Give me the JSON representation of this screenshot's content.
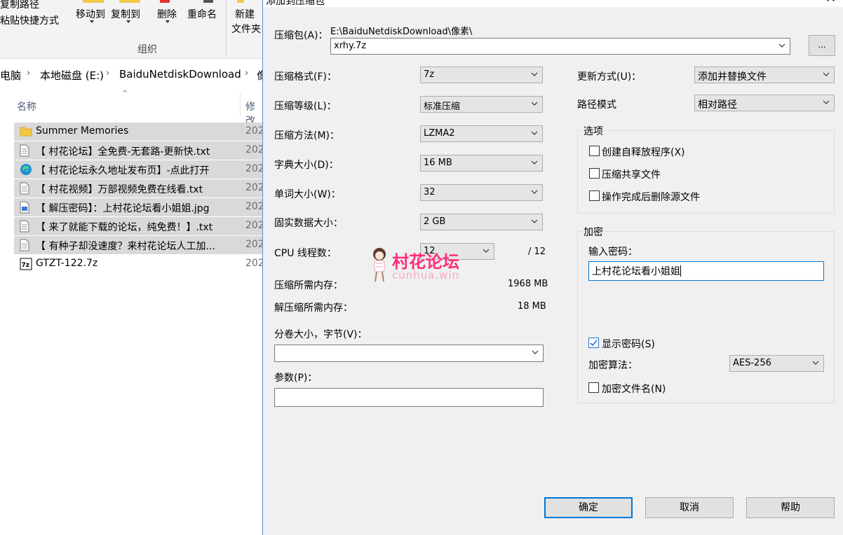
{
  "explorer": {
    "ribbon": {
      "copy_path": "复制路径",
      "paste_shortcut": "粘贴快捷方式",
      "move_to": "移动到",
      "copy_to": "复制到",
      "delete": "删除",
      "rename": "重命名",
      "new": "新建",
      "new_folder": "文件夹",
      "group_label": "组织"
    },
    "breadcrumb": [
      "电脑",
      "本地磁盘 (E:)",
      "BaiduNetdiskDownload",
      "像"
    ],
    "columns": {
      "name": "名称",
      "modified": "修改"
    },
    "files": [
      {
        "name": "Summer Memories",
        "date": "202",
        "icon": "folder-icon",
        "selected": true
      },
      {
        "name": "【 村花论坛】全免费-无套路-更新快.txt",
        "date": "202",
        "icon": "text-file-icon",
        "selected": true
      },
      {
        "name": "【 村花论坛永久地址发布页】-点此打开",
        "date": "202",
        "icon": "edge-browser-icon",
        "selected": true
      },
      {
        "name": "【 村花视频】万部视频免费在线看.txt",
        "date": "202",
        "icon": "text-file-icon",
        "selected": true
      },
      {
        "name": "【 解压密码】：上村花论坛看小姐姐.jpg",
        "date": "202",
        "icon": "image-file-icon",
        "selected": true
      },
      {
        "name": "【 来了就能下载的论坛，纯免费！】.txt",
        "date": "202",
        "icon": "text-file-icon",
        "selected": true
      },
      {
        "name": "【 有种子却没速度？来村花论坛人工加...",
        "date": "202",
        "icon": "text-file-icon",
        "selected": true
      },
      {
        "name": "GTZT-122.7z",
        "date": "202",
        "icon": "7z-archive-icon",
        "selected": false
      }
    ]
  },
  "dialog": {
    "title": "添加到压缩包",
    "archive_label": "压缩包(A)：",
    "archive_path": "E:\\BaiduNetdiskDownload\\像素\\",
    "archive_name": "xrhy.7z",
    "browse_label": "...",
    "left": {
      "format": {
        "label": "压缩格式(F)：",
        "value": "7z"
      },
      "level": {
        "label": "压缩等级(L)：",
        "value": "标准压缩"
      },
      "method": {
        "label": "压缩方法(M)：",
        "value": "LZMA2"
      },
      "dict": {
        "label": "字典大小(D)：",
        "value": "16 MB"
      },
      "word": {
        "label": "单词大小(W)：",
        "value": "32"
      },
      "solid": {
        "label": "固实数据大小：",
        "value": "2 GB"
      },
      "threads": {
        "label": "CPU 线程数：",
        "value": "12",
        "max": "/ 12"
      },
      "mem_compress": {
        "label": "压缩所需内存：",
        "value": "1968 MB"
      },
      "mem_decompress": {
        "label": "解压缩所需内存：",
        "value": "18 MB"
      },
      "volume": {
        "label": "分卷大小，字节(V)：",
        "value": ""
      },
      "params": {
        "label": "参数(P)：",
        "value": ""
      }
    },
    "right": {
      "update": {
        "label": "更新方式(U)：",
        "value": "添加并替换文件"
      },
      "path_mode": {
        "label": "路径模式",
        "value": "相对路径"
      },
      "options": {
        "title": "选项",
        "sfx": {
          "label": "创建自释放程序(X)",
          "checked": false
        },
        "shared": {
          "label": "压缩共享文件",
          "checked": false
        },
        "delete_after": {
          "label": "操作完成后删除源文件",
          "checked": false
        }
      },
      "encryption": {
        "title": "加密",
        "password_label": "输入密码：",
        "password": "上村花论坛看小姐姐",
        "show_password": {
          "label": "显示密码(S)",
          "checked": true
        },
        "algo_label": "加密算法：",
        "algo": "AES-256",
        "encrypt_names": {
          "label": "加密文件名(N)",
          "checked": false
        }
      }
    },
    "buttons": {
      "ok": "确定",
      "cancel": "取消",
      "help": "帮助"
    }
  },
  "watermark": {
    "title": "村花论坛",
    "subtitle": "cunhua.win"
  },
  "colors": {
    "accent": "#0078d7",
    "selection": "#d9d9d9",
    "watermark": "#ff2d7a"
  }
}
